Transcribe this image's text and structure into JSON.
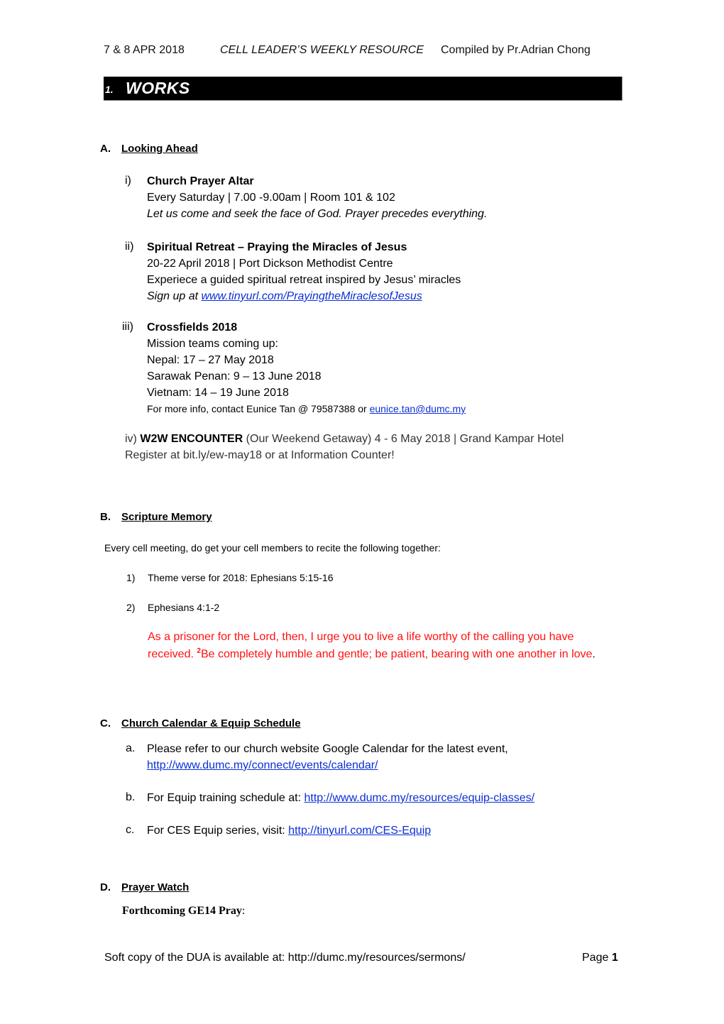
{
  "header": {
    "date": "7 & 8  APR 2018",
    "title": "CELL LEADER’S WEEKLY RESOURCE",
    "compiled_by": "Compiled by Pr.Adrian Chong"
  },
  "section_bar": {
    "number": "1.",
    "title": "WORKS"
  },
  "sections": {
    "a": {
      "letter": "A.",
      "heading": "Looking Ahead",
      "items": [
        {
          "numeral": "i)",
          "title": "Church Prayer Altar",
          "line1": "Every Saturday | 7.00 -9.00am | Room 101 & 102",
          "line2": "Let us come and seek the face of God. Prayer precedes everything."
        },
        {
          "numeral": "ii)",
          "title": "Spiritual Retreat – Praying the Miracles of Jesus",
          "line1": "20-22 April 2018 | Port Dickson Methodist Centre",
          "line2": "Experiece a guided spiritual retreat inspired by Jesus’ miracles",
          "signup_prefix": "Sign up at ",
          "signup_link": "www.tinyurl.com/PrayingtheMiraclesofJesus"
        },
        {
          "numeral": "iii)",
          "title": "Crossfields 2018",
          "intro": "Mission teams coming up:",
          "teams": [
            "Nepal: 17 – 27 May 2018",
            "Sarawak Penan: 9 – 13 June 2018",
            "Vietnam: 14 – 19 June 2018"
          ],
          "contact_prefix": "For more info, contact Eunice Tan @ 79587388 or ",
          "contact_email": "eunice.tan@dumc.my"
        },
        {
          "numeral": "iv)",
          "title": "W2W ENCOUNTER",
          "details": " (Our Weekend Getaway) 4 - 6 May 2018 | Grand Kampar Hotel",
          "register": "Register at   bit.ly/ew-may18 or at Information Counter!"
        }
      ]
    },
    "b": {
      "letter": "B.",
      "heading": "Scripture Memory",
      "intro": "Every cell meeting, do get your cell members to recite the following together:",
      "items": [
        {
          "num": "1)",
          "text": "Theme verse for 2018: Ephesians 5:15-16"
        },
        {
          "num": "2)",
          "text": "Ephesians 4:1-2"
        }
      ],
      "verse_part1": "As a prisoner for the Lord, then, I urge you to live a life worthy of the calling you have received. ",
      "verse_sup": "2",
      "verse_part2": "Be completely humble and gentle; be patient, bearing with one another in love",
      "verse_end": "."
    },
    "c": {
      "letter": "C.",
      "heading": "Church Calendar & Equip Schedule",
      "items": [
        {
          "marker": "a.",
          "text": "Please refer to our church website Google Calendar for the latest event,",
          "link": "http://www.dumc.my/connect/events/calendar/"
        },
        {
          "marker": "b.",
          "text": "For Equip training schedule at: ",
          "link": "http://www.dumc.my/resources/equip-classes/"
        },
        {
          "marker": "c.",
          "text": "For CES Equip series, visit: ",
          "link": "http://tinyurl.com/CES-Equip"
        }
      ]
    },
    "d": {
      "letter": "D.",
      "heading": "Prayer Watch",
      "subheading": "Forthcoming GE14 Pray",
      "subheading_suffix": ":"
    }
  },
  "footer": {
    "text": "Soft copy of the DUA is available at: http://dumc.my/resources/sermons/",
    "page_label": "Page ",
    "page_number": "1"
  }
}
